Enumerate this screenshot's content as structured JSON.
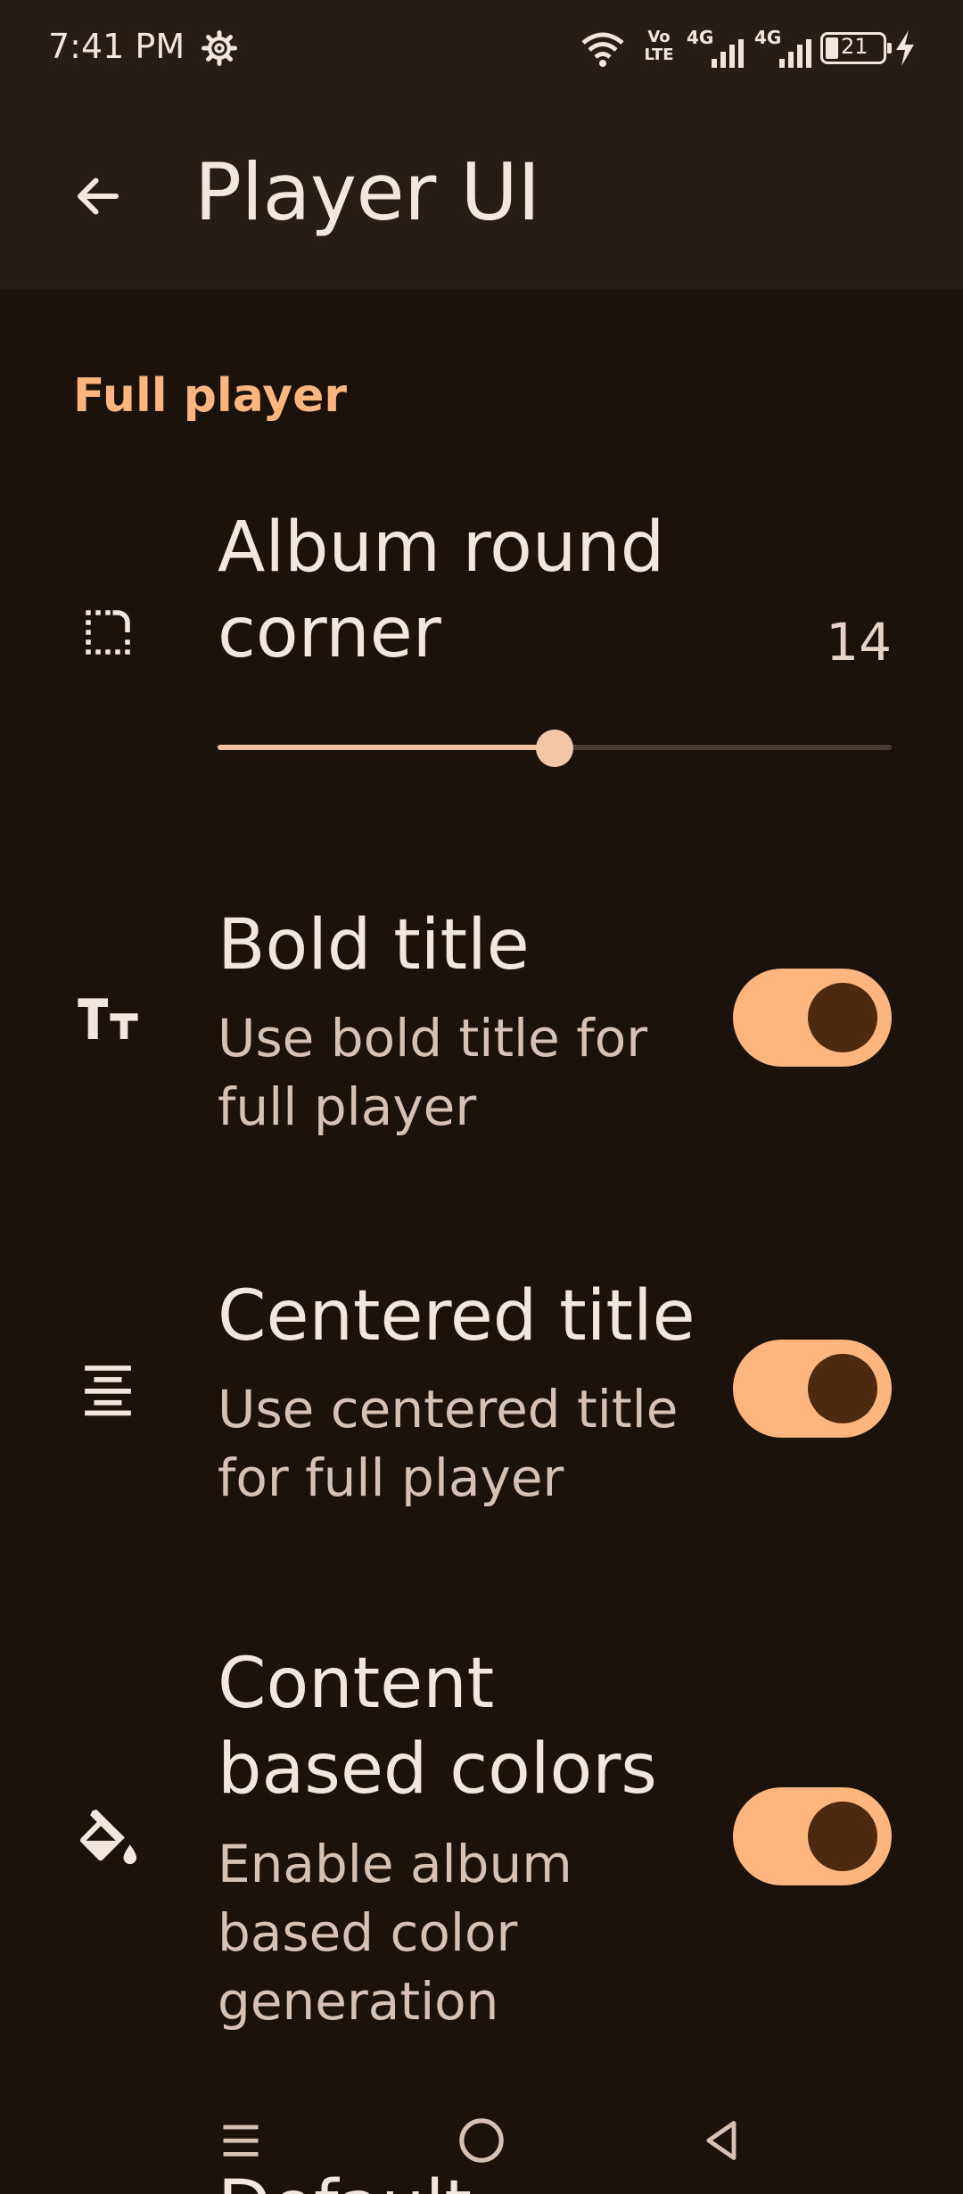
{
  "status_bar": {
    "time": "7:41 PM",
    "battery_level": "21",
    "network_labels": [
      "Vo LTE",
      "4G",
      "4G"
    ]
  },
  "app_bar": {
    "title": "Player UI"
  },
  "section": {
    "title": "Full player"
  },
  "settings": {
    "album_round_corner": {
      "title_line1": "Album round",
      "title_line2": "corner",
      "value": "14",
      "fraction": 0.5
    },
    "bold_title": {
      "title": "Bold title",
      "subtitle_line1": "Use bold title for",
      "subtitle_line2": "full player",
      "enabled": true
    },
    "centered_title": {
      "title": "Centered title",
      "subtitle_line1": "Use centered title",
      "subtitle_line2": "for full player",
      "enabled": true
    },
    "content_based_colors": {
      "title_line1": "Content",
      "title_line2": "based colors",
      "subtitle_line1": "Enable album",
      "subtitle_line2": "based color",
      "subtitle_line3": "generation",
      "enabled": true
    },
    "next_item_peek": "Default"
  },
  "icons": {
    "status_gear": "gear-icon",
    "back": "arrow-left-icon",
    "album_corner": "rounded-corner-icon",
    "bold_title": "text-size-icon",
    "centered_title": "align-center-icon",
    "content_colors": "paint-bucket-icon",
    "nav_recents": "menu-icon",
    "nav_home": "home-circle-icon",
    "nav_back": "back-triangle-icon"
  },
  "colors": {
    "accent": "#ffb57e",
    "background": "#1b120c",
    "appbar": "#261d17",
    "toggle_knob": "#4d2a0f"
  }
}
